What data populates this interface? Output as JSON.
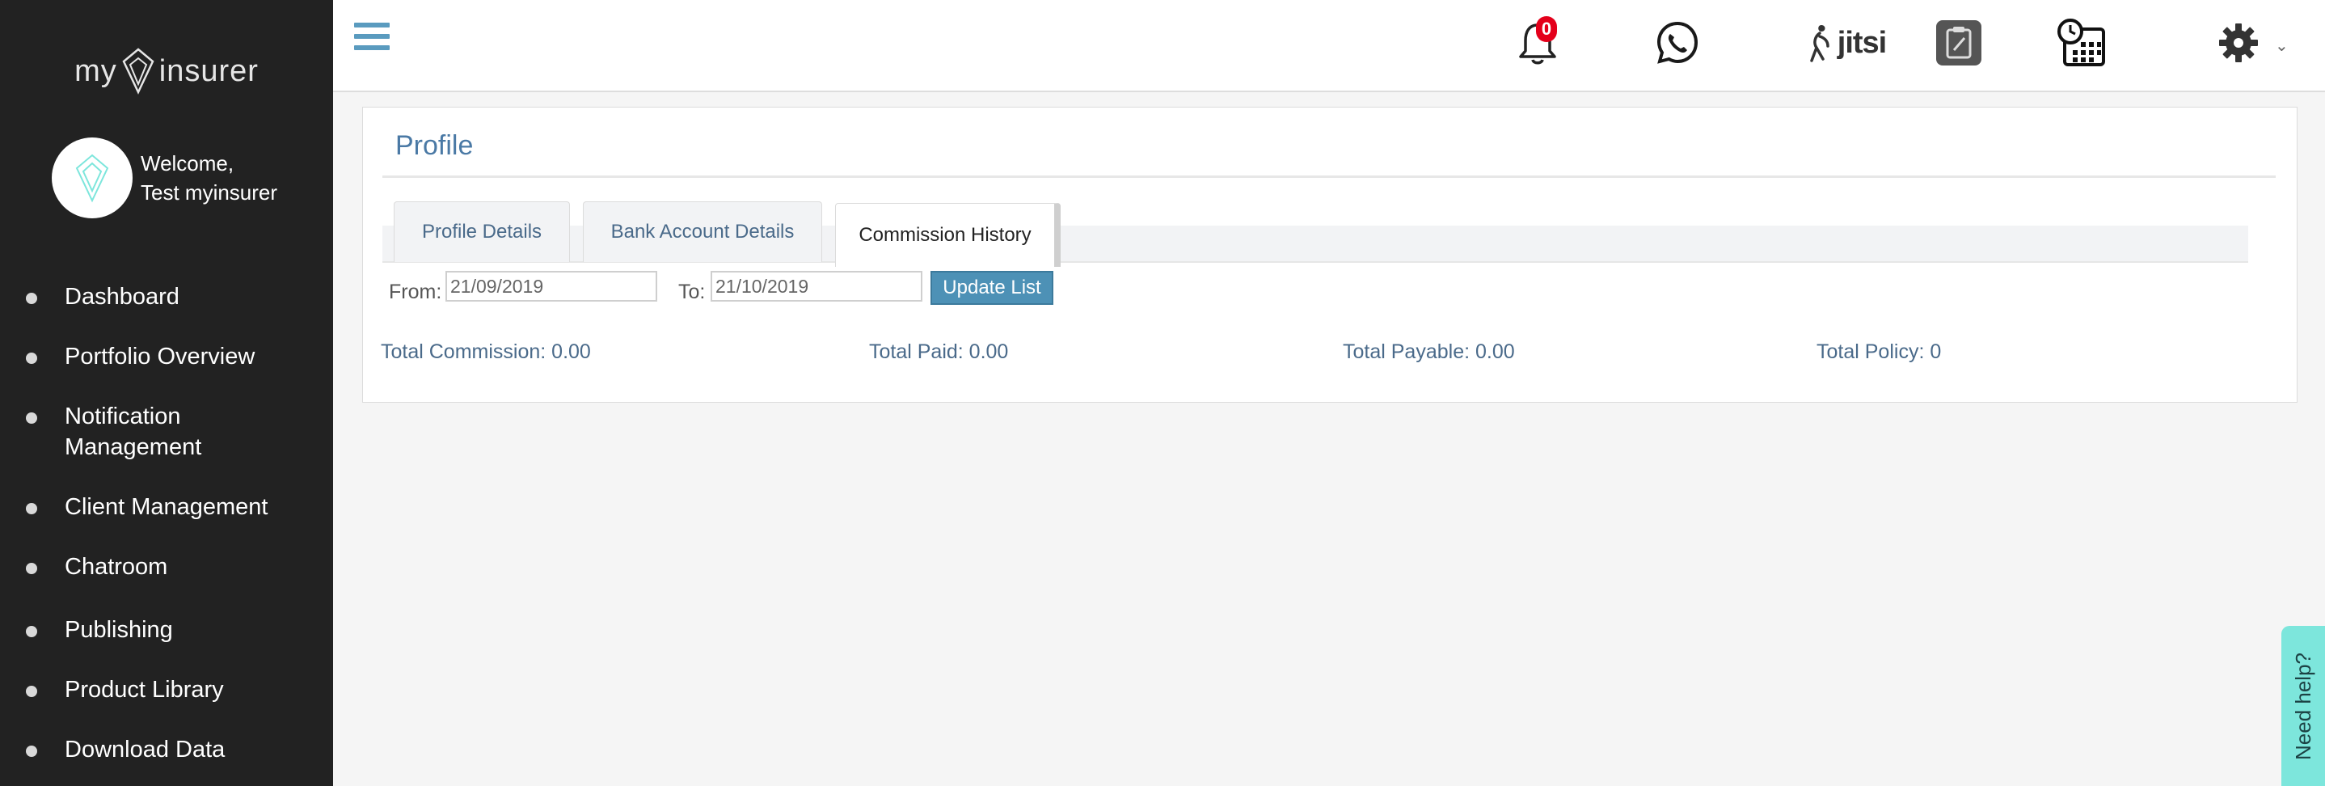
{
  "brand": {
    "logo_left": "my",
    "logo_right": "insurer",
    "accent_color": "#7de6dc"
  },
  "user": {
    "welcome_line1": "Welcome,",
    "welcome_line2": "Test myinsurer"
  },
  "sidebar": {
    "items": [
      {
        "label": "Dashboard"
      },
      {
        "label": "Portfolio Overview"
      },
      {
        "label": "Notification",
        "label2": "Management"
      },
      {
        "label": "Client Management"
      },
      {
        "label": "Chatroom"
      },
      {
        "label": "Publishing"
      },
      {
        "label": "Product Library"
      },
      {
        "label": "Download Data"
      }
    ]
  },
  "topbar": {
    "notification_count": "0",
    "icons": [
      "menu-icon",
      "bell-icon",
      "whatsapp-icon",
      "jitsi-icon",
      "clipboard-icon",
      "calendar-clock-icon",
      "gear-icon",
      "chevron-down-icon"
    ],
    "jitsi_label": "jitsi"
  },
  "page": {
    "title": "Profile",
    "tabs": [
      {
        "label": "Profile Details",
        "active": false
      },
      {
        "label": "Bank Account Details",
        "active": false
      },
      {
        "label": "Commission History",
        "active": true
      }
    ]
  },
  "filters": {
    "from_label": "From:",
    "from_value": "21/09/2019",
    "to_label": "To:",
    "to_value": "21/10/2019",
    "update_button": "Update List"
  },
  "totals": {
    "total_commission": "Total Commission: 0.00",
    "total_paid": "Total Paid: 0.00",
    "total_payable": "Total Payable: 0.00",
    "total_policy": "Total Policy: 0"
  },
  "help": {
    "label": "Need help?"
  }
}
